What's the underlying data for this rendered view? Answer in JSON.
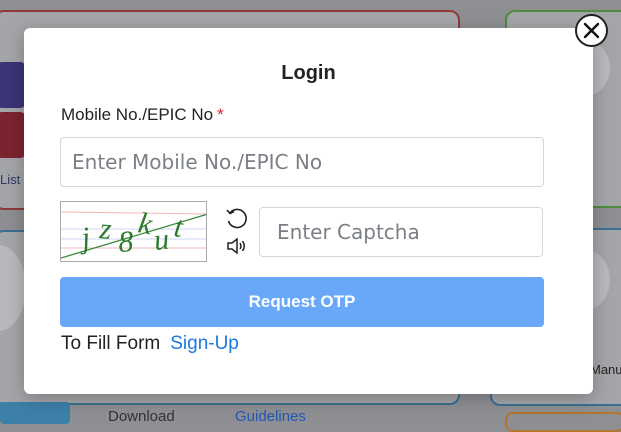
{
  "background": {
    "left_link_text": "List",
    "right_text": "Manu",
    "bottom_links": [
      "Download",
      "Guidelines"
    ]
  },
  "modal": {
    "title": "Login",
    "mobile_label": "Mobile No./EPIC No",
    "required_marker": "*",
    "mobile_placeholder": "Enter Mobile No./EPIC No",
    "captcha_text": "jz8kut",
    "refresh_icon": "refresh-icon",
    "audio_icon": "speaker-icon",
    "captcha_placeholder": "Enter Captcha",
    "request_otp_label": "Request OTP",
    "fill_form_text": "To Fill Form",
    "signup_label": "Sign-Up",
    "close_icon": "close-icon"
  },
  "colors": {
    "primary_button": "#69a8f8",
    "link": "#1a7ae0",
    "required": "#e02020",
    "overlay": "#8d8f92"
  }
}
